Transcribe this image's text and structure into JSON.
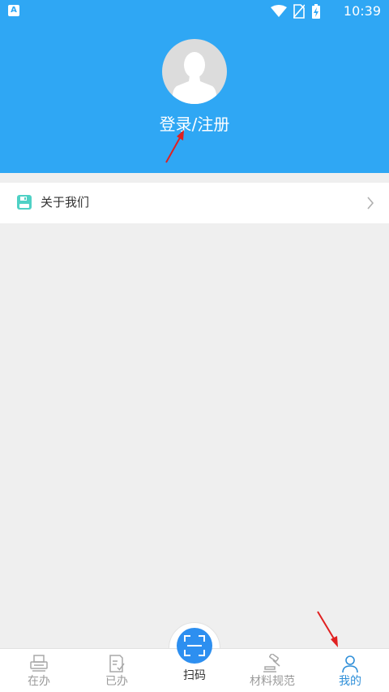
{
  "status_bar": {
    "app_badge": "A",
    "time": "10:39"
  },
  "profile": {
    "login_label": "登录/注册"
  },
  "list": {
    "items": [
      {
        "label": "关于我们",
        "icon": "floppy-save-icon"
      }
    ]
  },
  "bottom_nav": {
    "items": [
      {
        "label": "在办",
        "icon": "printer-icon"
      },
      {
        "label": "已办",
        "icon": "document-check-icon"
      },
      {
        "label": "扫码",
        "icon": "scan-icon"
      },
      {
        "label": "材料规范",
        "icon": "gavel-icon"
      },
      {
        "label": "我的",
        "icon": "person-icon",
        "active": true
      }
    ]
  },
  "colors": {
    "header": "#2fa7f4",
    "accent": "#2f8fd8",
    "scan_button": "#2d8ff0",
    "annotation_arrow": "#e02020"
  }
}
